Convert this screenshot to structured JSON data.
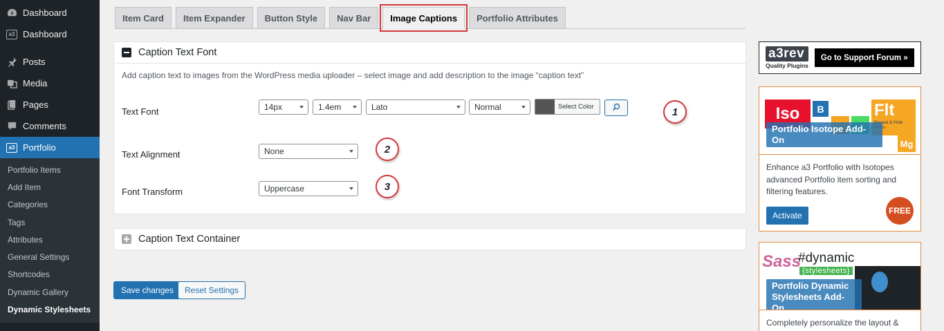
{
  "sidebar": {
    "items": [
      {
        "label": "Dashboard",
        "icon": "gauge-icon"
      },
      {
        "label": "Dashboard",
        "icon": "a3-icon"
      },
      {
        "label": "Posts",
        "icon": "pin-icon"
      },
      {
        "label": "Media",
        "icon": "media-icon"
      },
      {
        "label": "Pages",
        "icon": "pages-icon"
      },
      {
        "label": "Comments",
        "icon": "comment-icon"
      },
      {
        "label": "Portfolio",
        "icon": "a3-icon"
      }
    ],
    "submenu": [
      "Portfolio Items",
      "Add Item",
      "Categories",
      "Tags",
      "Attributes",
      "General Settings",
      "Shortcodes",
      "Dynamic Gallery",
      "Dynamic Stylesheets"
    ]
  },
  "tabs": [
    "Item Card",
    "Item Expander",
    "Button Style",
    "Nav Bar",
    "Image Captions",
    "Portfolio Attributes"
  ],
  "font_panel": {
    "title": "Caption Text Font",
    "description": "Add caption text to images from the WordPress media uploader – select image and add description to the image “caption text”",
    "text_font_label": "Text Font",
    "size": "14px",
    "line_height": "1.4em",
    "family": "Lato",
    "weight": "Normal",
    "color_label": "Select Color",
    "alignment_label": "Text Alignment",
    "alignment_value": "None",
    "transform_label": "Font Transform",
    "transform_value": "Uppercase",
    "markers": [
      "1",
      "2",
      "3"
    ]
  },
  "container_panel": {
    "title": "Caption Text Container"
  },
  "buttons": {
    "save": "Save changes",
    "reset": "Reset Settings"
  },
  "support": {
    "logo": "a3rev",
    "tagline": "Quality Plugins",
    "forum_label": "Go to Support Forum »"
  },
  "addon_isotope": {
    "title": "Portfolio Isotope Add-On",
    "tiles": [
      "Iso",
      "B",
      "Flt",
      "Reveal & Hide Items",
      "Mg"
    ],
    "text": "Enhance a3 Portfolio with Isotopes advanced Portfolio item sorting and filtering features.",
    "activate": "Activate",
    "badge": "FREE"
  },
  "addon_dynamic": {
    "title": "Portfolio Dynamic Stylesheets Add-On",
    "tag": "#dynamic",
    "sub": "{stylesheets}",
    "sass": "Sass",
    "text": "Completely personalize the layout &"
  },
  "colors": {
    "accent": "#2271b1",
    "sidebar": "#1d2327",
    "highlight": "#d63638",
    "addon_border": "#e58a3c"
  }
}
